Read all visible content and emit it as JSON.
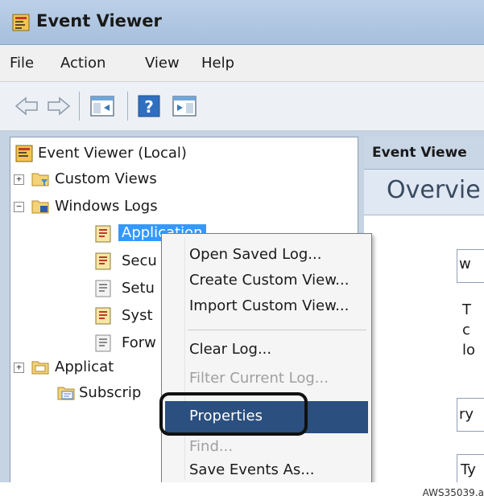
{
  "window": {
    "title": "Event Viewer",
    "app_icon": "event-viewer-icon"
  },
  "menubar": {
    "items": [
      "File",
      "Action",
      "View",
      "Help"
    ]
  },
  "toolbar": {
    "buttons": [
      "back-arrow-icon",
      "forward-arrow-icon",
      "show-hide-console-tree-icon",
      "help-icon",
      "show-hide-action-pane-icon"
    ]
  },
  "tree": {
    "root": "Event Viewer (Local)",
    "custom_views": "Custom Views",
    "windows_logs": "Windows Logs",
    "application": "Application",
    "security": "Secu",
    "setup": "Setu",
    "system": "Syst",
    "forwarded": "Forw",
    "applications_services": "Applicat",
    "subscriptions": "Subscrip"
  },
  "right_pane": {
    "header": "Event Viewe",
    "overview": "Overvie",
    "frag_w": "w",
    "frag_t": "T",
    "frag_c": "c",
    "frag_l": "lo",
    "frag_ry": "ry",
    "frag_ty": "Ty"
  },
  "context_menu": {
    "open_saved_log": "Open Saved Log...",
    "create_custom_view": "Create Custom View...",
    "import_custom_view": "Import Custom View...",
    "clear_log": "Clear Log...",
    "filter_current_log": "Filter Current Log...",
    "properties": "Properties",
    "find": "Find...",
    "save_events_as": "Save Events As..."
  },
  "caption": "AWS35039.a",
  "colors": {
    "selection": "#3399ff",
    "menu_highlight": "#2b4f7e",
    "callout": "#111111"
  }
}
